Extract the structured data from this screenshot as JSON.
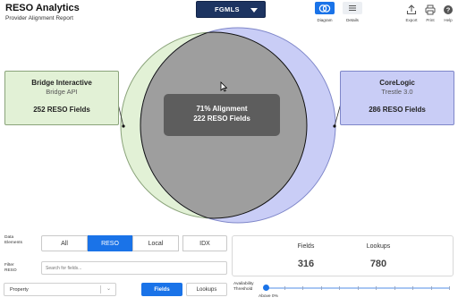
{
  "header": {
    "title": "RESO Analytics",
    "subtitle": "Provider Alignment Report",
    "org_select": "FGMLS",
    "views": [
      {
        "label": "Diagram",
        "icon": "venn-icon",
        "active": true
      },
      {
        "label": "Details",
        "icon": "list-icon",
        "active": false
      }
    ],
    "tools": [
      {
        "label": "Export",
        "icon": "export-icon"
      },
      {
        "label": "Print",
        "icon": "print-icon"
      },
      {
        "label": "Help",
        "icon": "help-icon"
      }
    ]
  },
  "venn": {
    "left": {
      "name": "Bridge Interactive",
      "api": "Bridge API",
      "fields": "252 RESO Fields",
      "color": "#e2f1d6"
    },
    "right": {
      "name": "CoreLogic",
      "api": "Trestle 3.0",
      "fields": "286 RESO Fields",
      "color": "#c9cdf6"
    },
    "overlap": {
      "alignment": "71% Alignment",
      "fields": "222 RESO Fields",
      "color": "#9e9e9e"
    }
  },
  "controls": {
    "data_elements_label": "Data\nElements",
    "segments": [
      {
        "label": "All",
        "active": false
      },
      {
        "label": "RESO",
        "active": true
      },
      {
        "label": "Local",
        "active": false
      },
      {
        "label": "IDX",
        "active": false
      }
    ],
    "filter_label": "Filter\nRESO",
    "search_placeholder": "Search for fields...",
    "resource_select": "Property",
    "fields_button": "Fields",
    "lookups_button": "Lookups",
    "availability_label": "Availability\nThreshold",
    "threshold_caption": "Above 0%",
    "threshold_value": 0
  },
  "stats": {
    "fields_label": "Fields",
    "fields_value": "316",
    "lookups_label": "Lookups",
    "lookups_value": "780"
  }
}
